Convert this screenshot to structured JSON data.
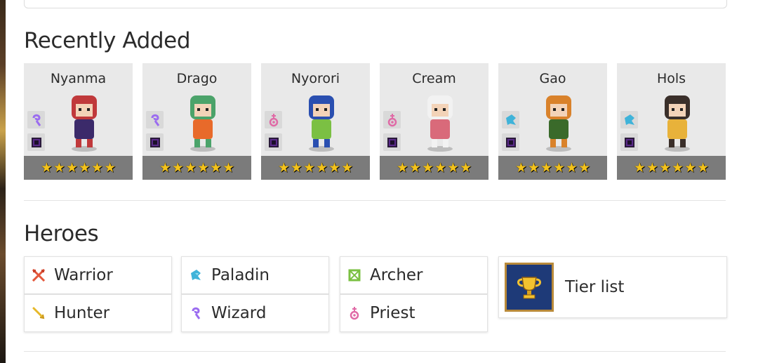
{
  "recently_added": {
    "title": "Recently Added",
    "heroes": [
      {
        "name": "Nyanma",
        "class": "wizard-icon",
        "stars": 6,
        "class_color": "#9b6cf0"
      },
      {
        "name": "Drago",
        "class": "wizard-icon",
        "stars": 6,
        "class_color": "#9b6cf0"
      },
      {
        "name": "Nyorori",
        "class": "priest-icon",
        "stars": 6,
        "class_color": "#e06aa6"
      },
      {
        "name": "Cream",
        "class": "priest-icon",
        "stars": 6,
        "class_color": "#e06aa6"
      },
      {
        "name": "Gao",
        "class": "paladin-icon",
        "stars": 6,
        "class_color": "#3fb3d9"
      },
      {
        "name": "Hols",
        "class": "paladin-icon",
        "stars": 6,
        "class_color": "#3fb3d9"
      }
    ]
  },
  "heroes_section": {
    "title": "Heroes",
    "roles": [
      {
        "label": "Warrior",
        "icon": "warrior-icon",
        "color": "#e4573b"
      },
      {
        "label": "Paladin",
        "icon": "paladin-icon",
        "color": "#3fb3d9"
      },
      {
        "label": "Archer",
        "icon": "archer-icon",
        "color": "#7bc043"
      },
      {
        "label": "Hunter",
        "icon": "hunter-icon",
        "color": "#e6b82a"
      },
      {
        "label": "Wizard",
        "icon": "wizard-icon",
        "color": "#9b6cf0"
      },
      {
        "label": "Priest",
        "icon": "priest-icon",
        "color": "#e06aa6"
      }
    ],
    "tier_list_label": "Tier list"
  }
}
